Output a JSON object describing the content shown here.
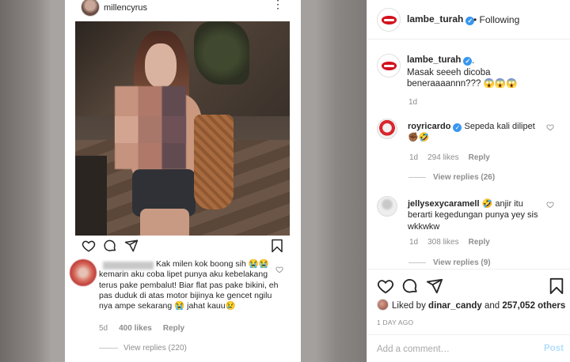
{
  "screenshot": {
    "username": "millencyrus",
    "comment": {
      "text": "Kak milen kok boong sih 😭😭 kemarin aku coba lipet punya aku kebelakang terus pake pembalut! Biar flat pas pake bikini,  eh pas duduk di atas motor bijinya ke gencet ngilu nya ampe sekarang 😭 jahat kauu😢",
      "time": "5d",
      "likes": "400 likes",
      "reply_label": "Reply",
      "view_replies": "View replies (220)"
    }
  },
  "panel": {
    "header": {
      "username": "lambe_turah",
      "separator": "•",
      "follow_label": "Following"
    },
    "caption": {
      "username": "lambe_turah",
      "text": ".\nMasak seeeh dicoba beneraaaannn??? 😱😱😱",
      "time": "1d"
    },
    "comments": [
      {
        "username": "royricardo",
        "text": "Sepeda kali dilipet ✊🏾🤣",
        "time": "1d",
        "likes": "294 likes",
        "reply_label": "Reply",
        "view_replies": "View replies (26)"
      },
      {
        "username": "jellysexycaramell",
        "text": "🤣 anjir itu berarti kegedungan punya yey sis wkkwkw",
        "time": "1d",
        "likes": "308 likes",
        "reply_label": "Reply",
        "view_replies": "View replies (9)"
      }
    ],
    "likes": {
      "prefix": "Liked by",
      "user": "dinar_candy",
      "conj": "and",
      "count": "257,052 others"
    },
    "post_time": "1 DAY AGO",
    "add_comment_placeholder": "Add a comment…",
    "post_label": "Post"
  },
  "colors": {
    "accent": "#3897f0",
    "post_disabled": "#b2dffc",
    "secondary_text": "#8e8e8e",
    "lips": "#d3121e"
  },
  "icons": [
    "more-icon",
    "heart-icon",
    "comment-icon",
    "share-icon",
    "bookmark-icon",
    "verified-badge-icon"
  ]
}
